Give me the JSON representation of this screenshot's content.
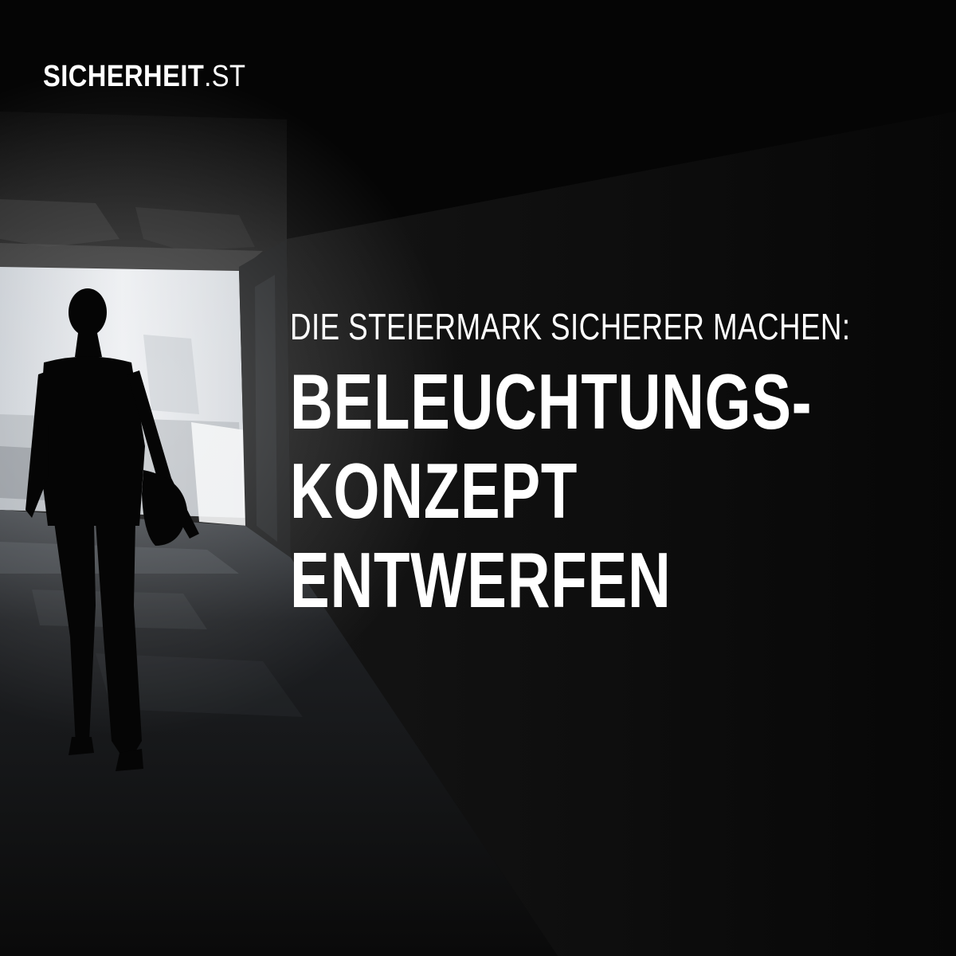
{
  "logo": {
    "brand": "SICHERHEIT",
    "tld": ".ST"
  },
  "headline": {
    "kicker": "DIE STEIERMARK SICHERER MACHEN:",
    "title_lines": [
      "BELEUCHTUNGS-",
      "KONZEPT",
      "ENTWERFEN"
    ]
  },
  "image": {
    "subject": "silhouette-person-walking-in-dark-underpass",
    "colors": {
      "background": "#050505",
      "light_wall": "#dfe2e6",
      "text": "#ffffff"
    }
  }
}
